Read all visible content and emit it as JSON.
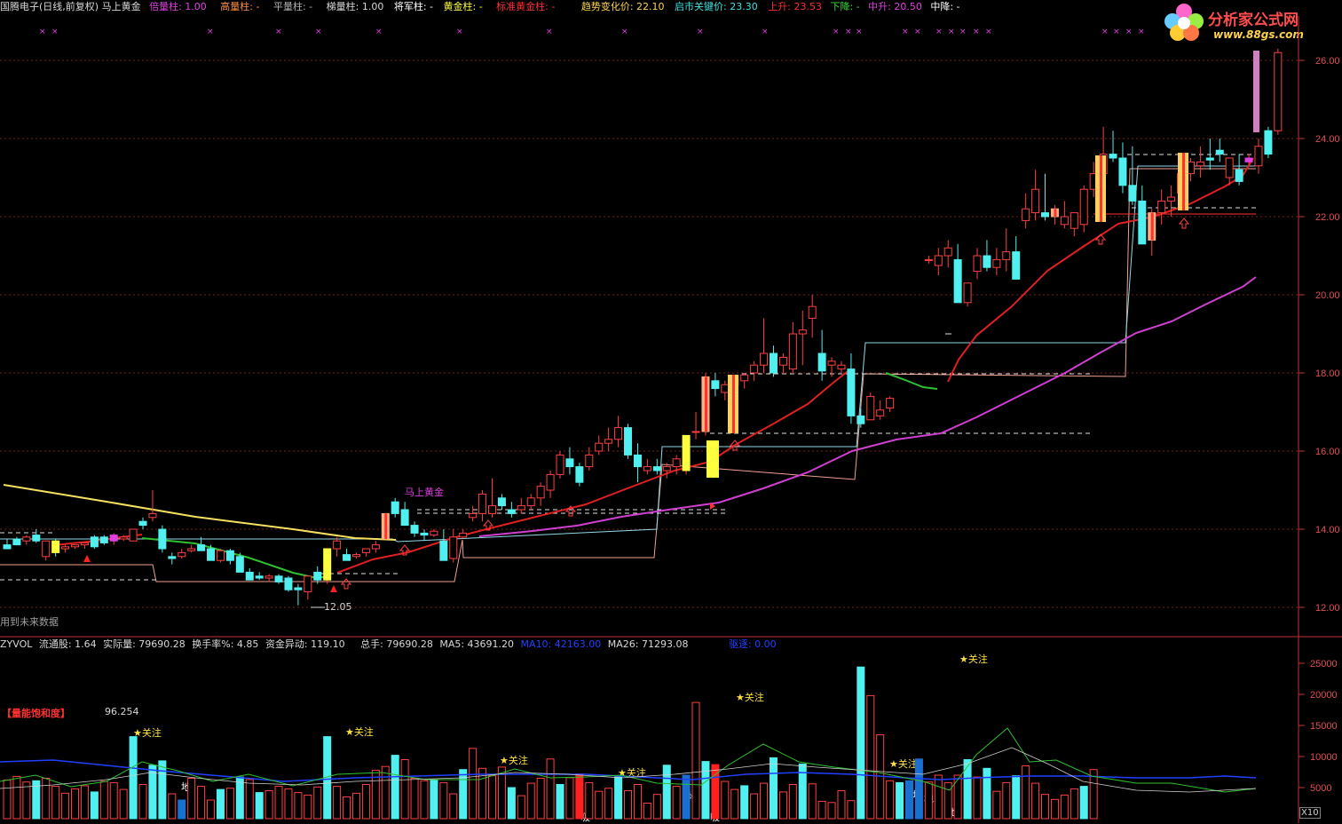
{
  "header": {
    "items": [
      {
        "text": "国腾电子(日线,前复权) 马上黄金",
        "color": "#d8d8d8"
      },
      {
        "text": "倍量柱: 1.00",
        "color": "#e040e0"
      },
      {
        "text": "高量柱: -",
        "color": "#ff9040"
      },
      {
        "text": "平量柱: -",
        "color": "#b0b0b0"
      },
      {
        "text": "梯量柱: 1.00",
        "color": "#d8d8d8"
      },
      {
        "text": "将军柱: -",
        "color": "#ffffff"
      },
      {
        "text": "黄金柱: -",
        "color": "#ffff40"
      },
      {
        "text": "标准黄金柱: -",
        "color": "#ff3030"
      },
      {
        "text": "趋势变化价: 22.10",
        "color": "#ffd24d"
      },
      {
        "text": "启市关键价: 23.30",
        "color": "#40e0e0"
      },
      {
        "text": "上升: 23.53",
        "color": "#ff3030"
      },
      {
        "text": "下降: -",
        "color": "#30e030"
      },
      {
        "text": "中升: 20.50",
        "color": "#e040e0"
      },
      {
        "text": "中降: -",
        "color": "#ffffff"
      }
    ]
  },
  "subheader": {
    "items": [
      {
        "text": "ZYVOL",
        "color": "#d8d8d8"
      },
      {
        "text": "流通股: 1.64",
        "color": "#d8d8d8"
      },
      {
        "text": "实际量: 79690.28",
        "color": "#d8d8d8"
      },
      {
        "text": "换手率%: 4.85",
        "color": "#d8d8d8"
      },
      {
        "text": "资金异动: 119.10",
        "color": "#d8d8d8"
      },
      {
        "text": "总手: 79690.28",
        "color": "#d8d8d8"
      },
      {
        "text": "MA5: 43691.20",
        "color": "#d8d8d8"
      },
      {
        "text": "MA10: 42163.00",
        "color": "#2040ff"
      },
      {
        "text": "MA26: 71293.08",
        "color": "#d8d8d8"
      },
      {
        "text": "驱逐: 0.00",
        "color": "#2040ff"
      }
    ]
  },
  "labels": {
    "future_data": "用到未来数据",
    "mashang": "马上黄金",
    "low_price": "12.05",
    "saturation_title": "【量能饱和度】",
    "saturation_value": "96.254",
    "attention": "★关注",
    "di": "地",
    "xi": "吸",
    "x10": "X10"
  },
  "logo": {
    "title": "分析家公式网",
    "url": "www.88gs.com"
  },
  "chart_data": [
    {
      "type": "candlestick",
      "title": "国腾电子(日线,前复权) 马上黄金",
      "ylim": [
        11.7,
        26.4
      ],
      "yticks": [
        12.0,
        14.0,
        16.0,
        18.0,
        20.0,
        22.0,
        24.0,
        26.0
      ],
      "grid": true,
      "candles": [
        [
          13.6,
          13.75,
          13.5,
          13.5
        ],
        [
          13.75,
          13.8,
          13.6,
          13.6
        ],
        [
          13.7,
          13.85,
          13.6,
          13.8
        ],
        [
          13.85,
          14.0,
          13.65,
          13.7
        ],
        [
          13.3,
          13.7,
          13.2,
          13.7
        ],
        [
          13.7,
          13.75,
          13.3,
          13.4
        ],
        [
          13.5,
          13.6,
          13.4,
          13.55
        ],
        [
          13.55,
          13.6,
          13.5,
          13.6
        ],
        [
          13.6,
          13.65,
          13.5,
          13.65
        ],
        [
          13.8,
          13.85,
          13.5,
          13.55
        ],
        [
          13.8,
          13.85,
          13.6,
          13.65
        ],
        [
          13.7,
          13.9,
          13.6,
          13.85
        ],
        [
          13.75,
          13.85,
          13.7,
          13.8
        ],
        [
          13.7,
          14.0,
          13.7,
          14.0
        ],
        [
          14.2,
          14.3,
          14.0,
          14.1
        ],
        [
          14.3,
          15.0,
          14.2,
          14.4
        ],
        [
          14.0,
          14.1,
          13.4,
          13.5
        ],
        [
          13.3,
          13.4,
          13.1,
          13.25
        ],
        [
          13.3,
          13.5,
          13.25,
          13.4
        ],
        [
          13.45,
          13.6,
          13.4,
          13.5
        ],
        [
          13.6,
          13.8,
          13.5,
          13.45
        ],
        [
          13.5,
          13.6,
          13.35,
          13.2
        ],
        [
          13.2,
          13.5,
          13.15,
          13.45
        ],
        [
          13.45,
          13.5,
          13.1,
          13.2
        ],
        [
          13.3,
          13.4,
          13.0,
          12.9
        ],
        [
          12.9,
          13.0,
          12.75,
          12.7
        ],
        [
          12.8,
          12.9,
          12.7,
          12.75
        ],
        [
          12.75,
          12.85,
          12.65,
          12.8
        ],
        [
          12.8,
          12.85,
          12.6,
          12.65
        ],
        [
          12.75,
          12.8,
          12.4,
          12.45
        ],
        [
          12.5,
          12.6,
          12.05,
          12.45
        ],
        [
          12.4,
          12.5,
          12.2,
          12.8
        ],
        [
          12.9,
          13.05,
          12.6,
          12.7
        ],
        [
          12.7,
          13.5,
          12.6,
          13.5
        ],
        [
          13.5,
          13.8,
          13.3,
          13.7
        ],
        [
          13.35,
          13.5,
          13.3,
          13.2
        ],
        [
          13.3,
          13.4,
          13.25,
          13.35
        ],
        [
          13.4,
          13.5,
          13.3,
          13.5
        ],
        [
          13.5,
          13.7,
          13.4,
          13.6
        ],
        [
          13.75,
          14.4,
          13.75,
          14.4
        ],
        [
          14.7,
          14.8,
          14.3,
          14.4
        ],
        [
          14.5,
          14.7,
          14.1,
          14.1
        ],
        [
          14.1,
          14.2,
          13.8,
          13.9
        ],
        [
          13.9,
          14.0,
          13.7,
          13.85
        ],
        [
          13.85,
          14.0,
          13.8,
          13.95
        ],
        [
          13.7,
          14.0,
          13.3,
          13.2
        ],
        [
          13.25,
          14.0,
          13.15,
          13.8
        ],
        [
          13.8,
          14.0,
          13.75,
          13.9
        ],
        [
          14.3,
          14.6,
          14.2,
          14.4
        ],
        [
          14.4,
          15.0,
          14.2,
          14.9
        ],
        [
          14.4,
          15.3,
          14.3,
          14.6
        ],
        [
          14.8,
          14.9,
          14.5,
          14.6
        ],
        [
          14.5,
          14.7,
          14.3,
          14.4
        ],
        [
          14.5,
          14.8,
          14.4,
          14.6
        ],
        [
          14.6,
          14.9,
          14.5,
          14.8
        ],
        [
          14.8,
          15.2,
          14.6,
          15.1
        ],
        [
          15.0,
          15.5,
          14.8,
          15.4
        ],
        [
          15.4,
          16.0,
          15.3,
          15.9
        ],
        [
          15.8,
          16.1,
          15.4,
          15.6
        ],
        [
          15.6,
          15.7,
          15.1,
          15.2
        ],
        [
          15.6,
          16.1,
          15.5,
          15.9
        ],
        [
          16.0,
          16.4,
          15.9,
          16.2
        ],
        [
          16.2,
          16.6,
          16.0,
          16.3
        ],
        [
          16.3,
          16.9,
          16.1,
          16.6
        ],
        [
          16.6,
          16.7,
          15.8,
          15.9
        ],
        [
          15.9,
          16.2,
          15.2,
          15.6
        ],
        [
          15.5,
          15.8,
          15.4,
          15.6
        ],
        [
          15.6,
          15.8,
          15.4,
          15.5
        ],
        [
          15.5,
          15.7,
          15.3,
          15.6
        ],
        [
          15.6,
          15.9,
          15.4,
          15.8
        ],
        [
          15.5,
          16.4,
          15.4,
          16.4
        ],
        [
          16.5,
          17.0,
          16.3,
          16.5
        ],
        [
          16.5,
          18.0,
          16.4,
          17.9
        ],
        [
          17.8,
          18.0,
          17.4,
          17.6
        ],
        [
          17.5,
          17.8,
          17.3,
          17.7
        ],
        [
          17.7,
          17.9,
          17.5,
          17.9
        ],
        [
          17.8,
          18.0,
          17.6,
          17.95
        ],
        [
          18.0,
          18.3,
          17.8,
          18.2
        ],
        [
          18.2,
          19.4,
          18.0,
          18.5
        ],
        [
          18.5,
          18.7,
          17.9,
          18.0
        ],
        [
          18.2,
          18.5,
          18.0,
          18.4
        ],
        [
          18.1,
          19.3,
          18.0,
          19.0
        ],
        [
          19.0,
          19.6,
          18.2,
          19.1
        ],
        [
          19.4,
          20.0,
          18.9,
          19.7
        ],
        [
          18.5,
          19.1,
          17.8,
          18.05
        ],
        [
          18.2,
          18.4,
          17.9,
          18.3
        ],
        [
          18.1,
          18.3,
          18.0,
          18.2
        ],
        [
          18.1,
          18.5,
          16.7,
          16.9
        ],
        [
          16.9,
          17.1,
          16.6,
          16.7
        ],
        [
          16.8,
          17.5,
          16.8,
          17.4
        ],
        [
          16.9,
          17.3,
          16.8,
          17.05
        ],
        [
          17.1,
          17.4,
          17.0,
          17.35
        ],
        [
          17.6,
          17.6,
          17.6,
          17.6
        ],
        [
          17.6,
          17.6,
          17.6,
          17.6
        ],
        [
          17.6,
          17.6,
          17.6,
          17.6
        ],
        [
          20.9,
          21.0,
          20.8,
          20.9
        ],
        [
          20.75,
          21.2,
          20.5,
          21.0
        ],
        [
          21.0,
          21.4,
          20.7,
          21.2
        ],
        [
          20.9,
          21.3,
          19.8,
          19.8
        ],
        [
          19.8,
          20.3,
          19.7,
          20.3
        ],
        [
          20.6,
          21.2,
          20.4,
          21.0
        ],
        [
          21.0,
          21.4,
          20.6,
          20.7
        ],
        [
          20.7,
          21.2,
          20.5,
          20.9
        ],
        [
          20.9,
          21.7,
          20.6,
          21.1
        ],
        [
          21.1,
          21.5,
          20.5,
          20.4
        ],
        [
          21.9,
          22.6,
          21.7,
          22.2
        ],
        [
          22.1,
          23.2,
          21.9,
          22.7
        ],
        [
          22.1,
          23.1,
          21.9,
          22.0
        ],
        [
          22.0,
          22.3,
          21.8,
          22.2
        ],
        [
          21.8,
          22.4,
          21.7,
          22.0
        ],
        [
          21.7,
          22.0,
          21.5,
          22.1
        ],
        [
          21.8,
          22.8,
          21.6,
          22.7
        ],
        [
          22.7,
          23.4,
          22.5,
          23.1
        ],
        [
          23.1,
          24.3,
          22.7,
          23.6
        ],
        [
          23.6,
          24.2,
          23.4,
          23.5
        ],
        [
          23.5,
          23.9,
          22.6,
          22.8
        ],
        [
          22.8,
          23.8,
          22.3,
          22.4
        ],
        [
          22.4,
          22.8,
          21.4,
          21.3
        ],
        [
          21.4,
          22.2,
          21.0,
          22.1
        ],
        [
          22.1,
          22.7,
          21.8,
          22.4
        ],
        [
          22.4,
          22.8,
          22.0,
          22.5
        ],
        [
          22.6,
          23.2,
          22.3,
          23.1
        ],
        [
          23.1,
          23.5,
          22.9,
          23.4
        ],
        [
          23.3,
          23.8,
          23.0,
          23.4
        ],
        [
          23.5,
          24.0,
          23.2,
          23.45
        ],
        [
          23.7,
          24.0,
          23.4,
          23.6
        ],
        [
          23.0,
          23.5,
          22.8,
          23.5
        ],
        [
          23.2,
          23.6,
          22.8,
          22.9
        ],
        [
          23.4,
          23.6,
          23.3,
          23.5
        ],
        [
          23.3,
          24.0,
          23.1,
          23.8
        ],
        [
          24.2,
          24.3,
          23.5,
          23.6
        ],
        [
          24.2,
          26.3,
          24.1,
          26.2
        ]
      ],
      "lines": {
        "upper_yellow_descending": [
          15.2,
          14.7,
          14.3,
          13.75
        ],
        "red_rising_ma": "from 13.9 near day 12 to 23.5 at latest",
        "magenta_long_ma": "from 13.9 near day 40 to 20.5 at latest"
      },
      "annotations": [
        {
          "text": "马上黄金",
          "near_price": 15.2
        },
        {
          "text": "12.05",
          "price": 12.05
        }
      ]
    },
    {
      "type": "bar",
      "title": "ZYVOL",
      "ylim": [
        0,
        27000
      ],
      "yticks": [
        5000,
        10000,
        15000,
        20000,
        25000
      ],
      "values": [
        6200,
        6800,
        5900,
        6100,
        6500,
        5200,
        4100,
        4800,
        5300,
        4300,
        6000,
        5800,
        4700,
        13200,
        5500,
        8600,
        9300,
        4000,
        3000,
        6500,
        5200,
        3000,
        4700,
        4900,
        6700,
        6300,
        4200,
        4500,
        5200,
        4800,
        4200,
        3800,
        5100,
        13200,
        5200,
        3500,
        4100,
        5500,
        7800,
        8400,
        10200,
        9500,
        6500,
        6100,
        6200,
        5800,
        4000,
        7900,
        11300,
        8100,
        6900,
        8300,
        5000,
        3700,
        5700,
        6500,
        9600,
        5500,
        6600,
        7200,
        5800,
        4400,
        4900,
        6700,
        4500,
        5500,
        2500,
        3900,
        8600,
        5200,
        7000,
        18700,
        9200,
        8700,
        6000,
        4700,
        5300,
        4000,
        5700,
        9800,
        4300,
        5500,
        8800,
        5600,
        2800,
        2600,
        4500,
        2900,
        24400,
        19800,
        13500,
        6100,
        5800,
        6100,
        9600,
        5900,
        7000,
        5800,
        7000,
        9500,
        6700,
        8100,
        4400,
        5800,
        6900,
        8500,
        5700,
        3900,
        3100,
        3800,
        4800,
        5200,
        7900
      ],
      "ma5_line": "thin green oscillating line",
      "ma10_line": "blue slowly varying line near 7000-8000",
      "labels": [
        "★关注",
        "地",
        "吸",
        "地",
        "吸",
        "地",
        "地"
      ]
    }
  ]
}
